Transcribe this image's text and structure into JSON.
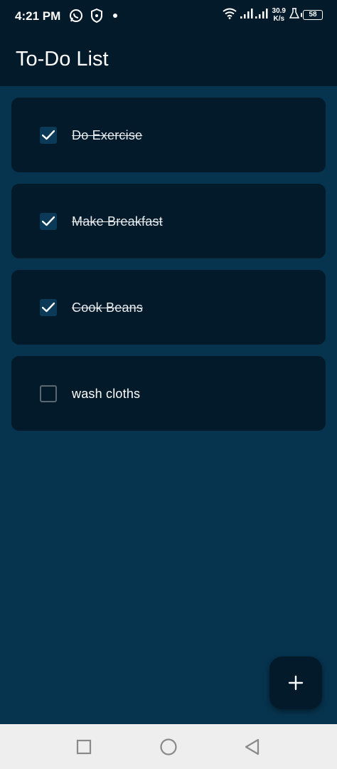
{
  "status_bar": {
    "time": "4:21 PM",
    "net_speed_value": "30.9",
    "net_speed_unit": "K/s",
    "battery": "58",
    "icons": [
      "whatsapp-icon",
      "shield-icon",
      "dot-icon",
      "wifi-icon",
      "signal-icon",
      "flask-icon",
      "battery-icon"
    ]
  },
  "app_bar": {
    "title": "To-Do List"
  },
  "tasks": [
    {
      "label": "Do Exercise",
      "done": true
    },
    {
      "label": "Make Breakfast",
      "done": true
    },
    {
      "label": "Cook Beans",
      "done": true
    },
    {
      "label": "wash cloths",
      "done": false
    }
  ],
  "fab": {
    "icon": "plus-icon"
  },
  "nav_bar": {
    "icons": [
      "recents-square-icon",
      "home-circle-icon",
      "back-triangle-icon"
    ]
  },
  "colors": {
    "background": "#06334e",
    "surface": "#021a29",
    "checkbox_fill": "#0a3a58",
    "nav_bar": "#eeeeee"
  }
}
